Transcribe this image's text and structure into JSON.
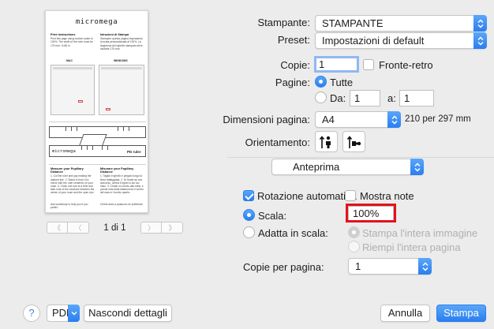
{
  "preview": {
    "doc": {
      "brand": "micromega",
      "left_title": "Print instructions",
      "left_text": "Print this page using custom scale to 100%. The width of the ruler must be 175 mm / 6.88 in",
      "right_title": "Istruzioni di Stampa",
      "right_text": "Stampare questa pagina impostando la scala personalizzata al 100%. La larghezza del righello stampato deve risultare 175 mm.",
      "mac_label": "MAC",
      "windows_label": "WINDOWS",
      "ruler_label": "PD ruler",
      "footer_left_title": "Measure your Pupillary Distance",
      "footer_left_text": "1. Cut the ruler and pay making the dashed line. 2. Stand in front of a mirror with the ruler centered on your nose. 3. Close one eye at a time and take note of the measure between the center of your nose and the open eye.",
      "footer_right_title": "Misurare your Pupillary Distance",
      "footer_right_text": "1. Taglia il righello e piegalo lungo la linea tratteggiata. 2. Di fronte ad uno specchio, centra il righel lo sul tuo naso. 3. Chiudi un occhio alla volta, e prendi nota della distanza tra il centro del naso e l'occhio aperto.",
      "footer_left_note": "Ask somebody to help you if you prefer!",
      "footer_right_note": "Chiedi aiuto a qualcuno se preferisci!"
    },
    "page_indicator": "1 di 1",
    "nav": {
      "first": "《",
      "prev": "〈",
      "next": "〉",
      "last": "》"
    }
  },
  "settings": {
    "printer": {
      "label": "Stampante:",
      "value": "STAMPANTE"
    },
    "preset": {
      "label": "Preset:",
      "value": "Impostazioni di default"
    },
    "copies": {
      "label": "Copie:",
      "value": "1",
      "duplex_label": "Fronte-retro",
      "duplex_checked": false
    },
    "pages": {
      "label": "Pagine:",
      "all_label": "Tutte",
      "from_label": "Da:",
      "from_value": "1",
      "to_label": "a:",
      "to_value": "1",
      "selected": "all"
    },
    "paper_size": {
      "label": "Dimensioni pagina:",
      "value": "A4",
      "dimensions": "210 per 297 mm"
    },
    "orientation": {
      "label": "Orientamento:",
      "selected": "portrait"
    },
    "section": {
      "value": "Anteprima"
    },
    "auto_rotate": {
      "label": "Rotazione automatica",
      "checked": true
    },
    "show_notes": {
      "label": "Mostra note",
      "checked": false
    },
    "scale": {
      "label": "Scala:",
      "value": "100%",
      "selected": true
    },
    "fit_scale": {
      "label": "Adatta in scala:",
      "option_print": "Stampa l'intera immagine",
      "option_fill": "Riempi l'intera pagina"
    },
    "pages_per_sheet": {
      "label": "Copie per pagina:",
      "value": "1"
    }
  },
  "footer": {
    "help": "?",
    "pdf": "PDF",
    "hide_details": "Nascondi dettagli",
    "cancel": "Annulla",
    "print": "Stampa"
  },
  "colors": {
    "accent": "#2a7ef0",
    "highlight": "#e2131b",
    "background": "#ececec"
  }
}
